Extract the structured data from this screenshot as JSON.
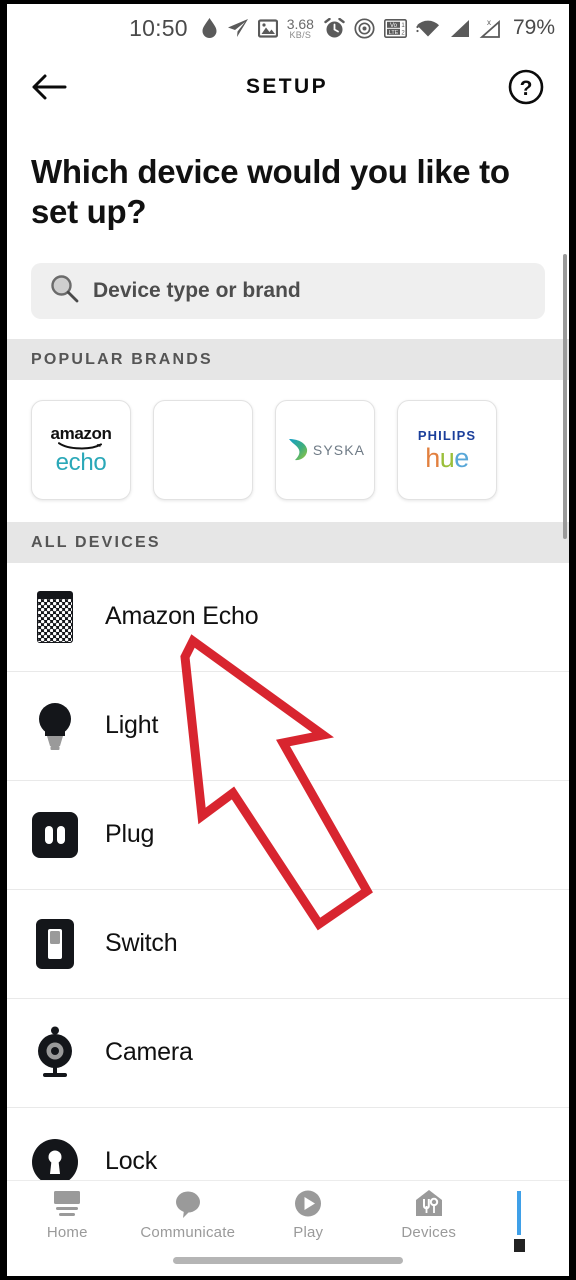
{
  "statusbar": {
    "time": "10:50",
    "data_speed_value": "3.68",
    "data_speed_unit": "KB/S",
    "battery": "79%",
    "icons": [
      "water-drop-icon",
      "telegram-send-icon",
      "image-icon",
      "alarm-clock-icon",
      "hotspot-icon",
      "volte-icon",
      "wifi-icon",
      "signal-bars-icon",
      "signal-no-service-icon"
    ]
  },
  "header": {
    "title": "SETUP",
    "back_icon": "back-arrow-icon",
    "help_icon": "help-question-icon"
  },
  "headline": "Which device would you like to set up?",
  "search": {
    "placeholder": "Device type or brand",
    "icon": "search-magnifier-icon"
  },
  "popular_brands": {
    "section_title": "POPULAR BRANDS",
    "cards": [
      {
        "name": "amazon-echo",
        "line1": "amazon",
        "line2": "echo",
        "color": "#2aa8b8"
      },
      {
        "name": "blank-brand",
        "line1": "",
        "line2": "",
        "color": "#ffffff"
      },
      {
        "name": "syska",
        "line1": "",
        "line2": "SYSKA",
        "color": "#6f7b86"
      },
      {
        "name": "philips-hue",
        "line1": "PHILIPS",
        "line2": "hue",
        "color": "#1b3f9b"
      }
    ]
  },
  "all_devices": {
    "section_title": "ALL DEVICES",
    "items": [
      {
        "label": "Amazon Echo",
        "icon": "echo-speaker-icon"
      },
      {
        "label": "Light",
        "icon": "light-bulb-icon"
      },
      {
        "label": "Plug",
        "icon": "plug-outlet-icon"
      },
      {
        "label": "Switch",
        "icon": "wall-switch-icon"
      },
      {
        "label": "Camera",
        "icon": "camera-icon"
      },
      {
        "label": "Lock",
        "icon": "lock-keyhole-icon"
      }
    ]
  },
  "bottom_nav": {
    "items": [
      {
        "label": "Home",
        "icon": "home-icon"
      },
      {
        "label": "Communicate",
        "icon": "speech-bubble-icon"
      },
      {
        "label": "Play",
        "icon": "play-circle-icon"
      },
      {
        "label": "Devices",
        "icon": "devices-house-icon"
      }
    ]
  },
  "annotation": {
    "type": "arrow",
    "color": "#d8252f",
    "points_to": "Amazon Echo"
  },
  "colors": {
    "accent_teal": "#2aa8b8",
    "annotation_red": "#d8252f",
    "section_bg": "#e6e6e6",
    "search_bg": "#efefef"
  }
}
